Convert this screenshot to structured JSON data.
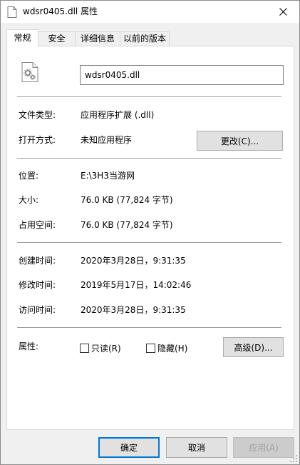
{
  "window": {
    "title": "wdsr0405.dll 属性"
  },
  "tabs": [
    {
      "label": "常规"
    },
    {
      "label": "安全"
    },
    {
      "label": "详细信息"
    },
    {
      "label": "以前的版本"
    }
  ],
  "general": {
    "file_name": "wdsr0405.dll",
    "file_type": {
      "label": "文件类型:",
      "value": "应用程序扩展 (.dll)"
    },
    "opens_with": {
      "label": "打开方式:",
      "value": "未知应用程序",
      "change_button": "更改(C)..."
    },
    "location": {
      "label": "位置:",
      "value": "E:\\3H3当游网"
    },
    "size": {
      "label": "大小:",
      "value": "76.0 KB (77,824 字节)"
    },
    "size_on_disk": {
      "label": "占用空间:",
      "value": "76.0 KB (77,824 字节)"
    },
    "created": {
      "label": "创建时间:",
      "value": "2020年3月28日，9:31:35"
    },
    "modified": {
      "label": "修改时间:",
      "value": "2019年5月17日，14:02:46"
    },
    "accessed": {
      "label": "访问时间:",
      "value": "2020年3月28日，9:31:35"
    },
    "attributes": {
      "label": "属性:",
      "readonly": "只读(R)",
      "hidden": "隐藏(H)",
      "advanced_button": "高级(D)..."
    }
  },
  "footer": {
    "ok": "确定",
    "cancel": "取消",
    "apply": "应用(A)"
  },
  "colors": {
    "focus_border": "#0078d7",
    "button_face": "#e1e1e1"
  }
}
